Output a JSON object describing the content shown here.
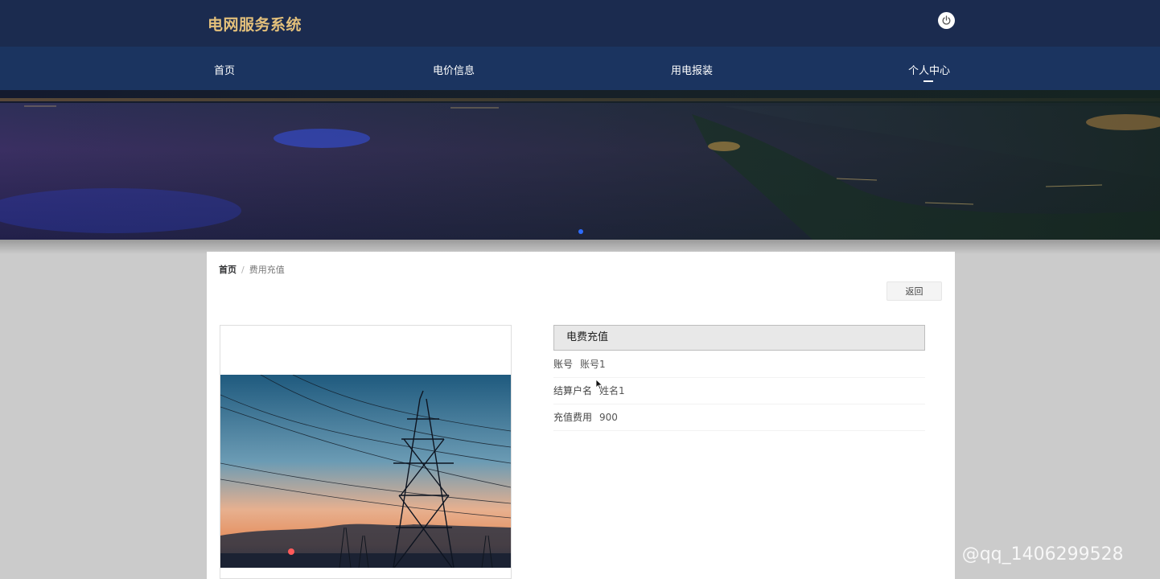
{
  "header": {
    "site_title": "电网服务系统",
    "logout_icon": "power-icon"
  },
  "nav": {
    "items": [
      {
        "label": "首页"
      },
      {
        "label": "电价信息"
      },
      {
        "label": "用电报装"
      },
      {
        "label": "个人中心"
      }
    ],
    "active_index": 3
  },
  "banner": {
    "image_name": "night-riverside-city-image",
    "active_slide": 1
  },
  "breadcrumb": {
    "home": "首页",
    "separator": "/",
    "current": "费用充值"
  },
  "actions": {
    "back_label": "返回"
  },
  "product_image": {
    "image_name": "power-tower-sunset-image"
  },
  "detail": {
    "section_title": "电费充值",
    "fields": [
      {
        "label": "账号",
        "value": "账号1"
      },
      {
        "label": "结算户名",
        "value": "姓名1"
      },
      {
        "label": "充值费用",
        "value": "900"
      }
    ]
  },
  "watermark": "CSDN @qq_1406299528",
  "colors": {
    "topbar": "#1b2b4f",
    "navbar": "#1b3460",
    "title_gold": "#e3c07b",
    "page_bg": "#cbcbcb",
    "accent_blue": "#2e6cff"
  }
}
